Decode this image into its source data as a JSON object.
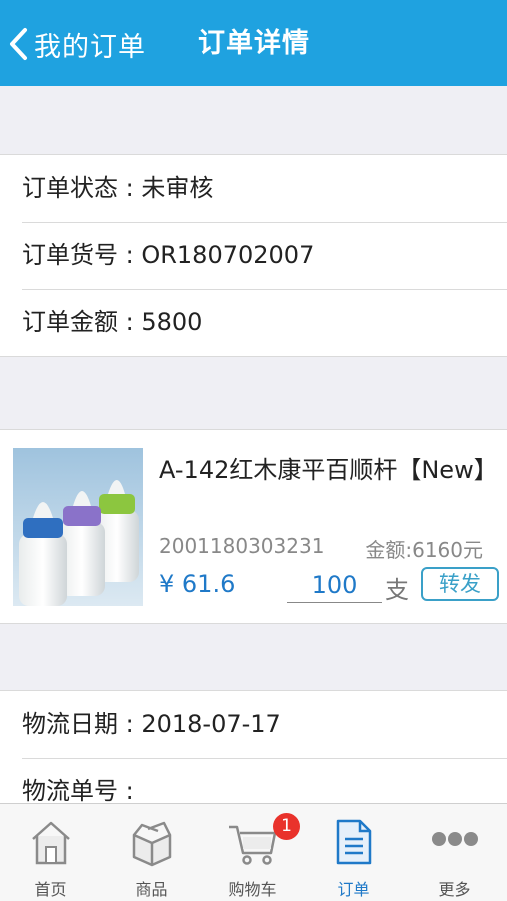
{
  "nav": {
    "back_label": "我的订单",
    "title": "订单详情"
  },
  "order": {
    "status": "订单状态 : 未审核",
    "number": "订单货号 : OR180702007",
    "amount": "订单金额 : 5800"
  },
  "product": {
    "name": "A-142红木康平百顺杆【New】",
    "code": "2001180303231",
    "amount": "金额:6160元",
    "price": "¥ 61.6",
    "quantity": "100",
    "unit": "支",
    "forward_label": "转发"
  },
  "logistics": {
    "date": "物流日期 : 2018-07-17",
    "number": "物流单号 :"
  },
  "tabs": [
    {
      "label": "首页",
      "icon": "home-icon"
    },
    {
      "label": "商品",
      "icon": "box-icon"
    },
    {
      "label": "购物车",
      "icon": "cart-icon",
      "badge": "1"
    },
    {
      "label": "订单",
      "icon": "document-icon",
      "active": true
    },
    {
      "label": "更多",
      "icon": "more-icon"
    }
  ],
  "colors": {
    "nav_bg": "#1fa2e0",
    "accent": "#1f79c8",
    "badge": "#e9322b"
  }
}
